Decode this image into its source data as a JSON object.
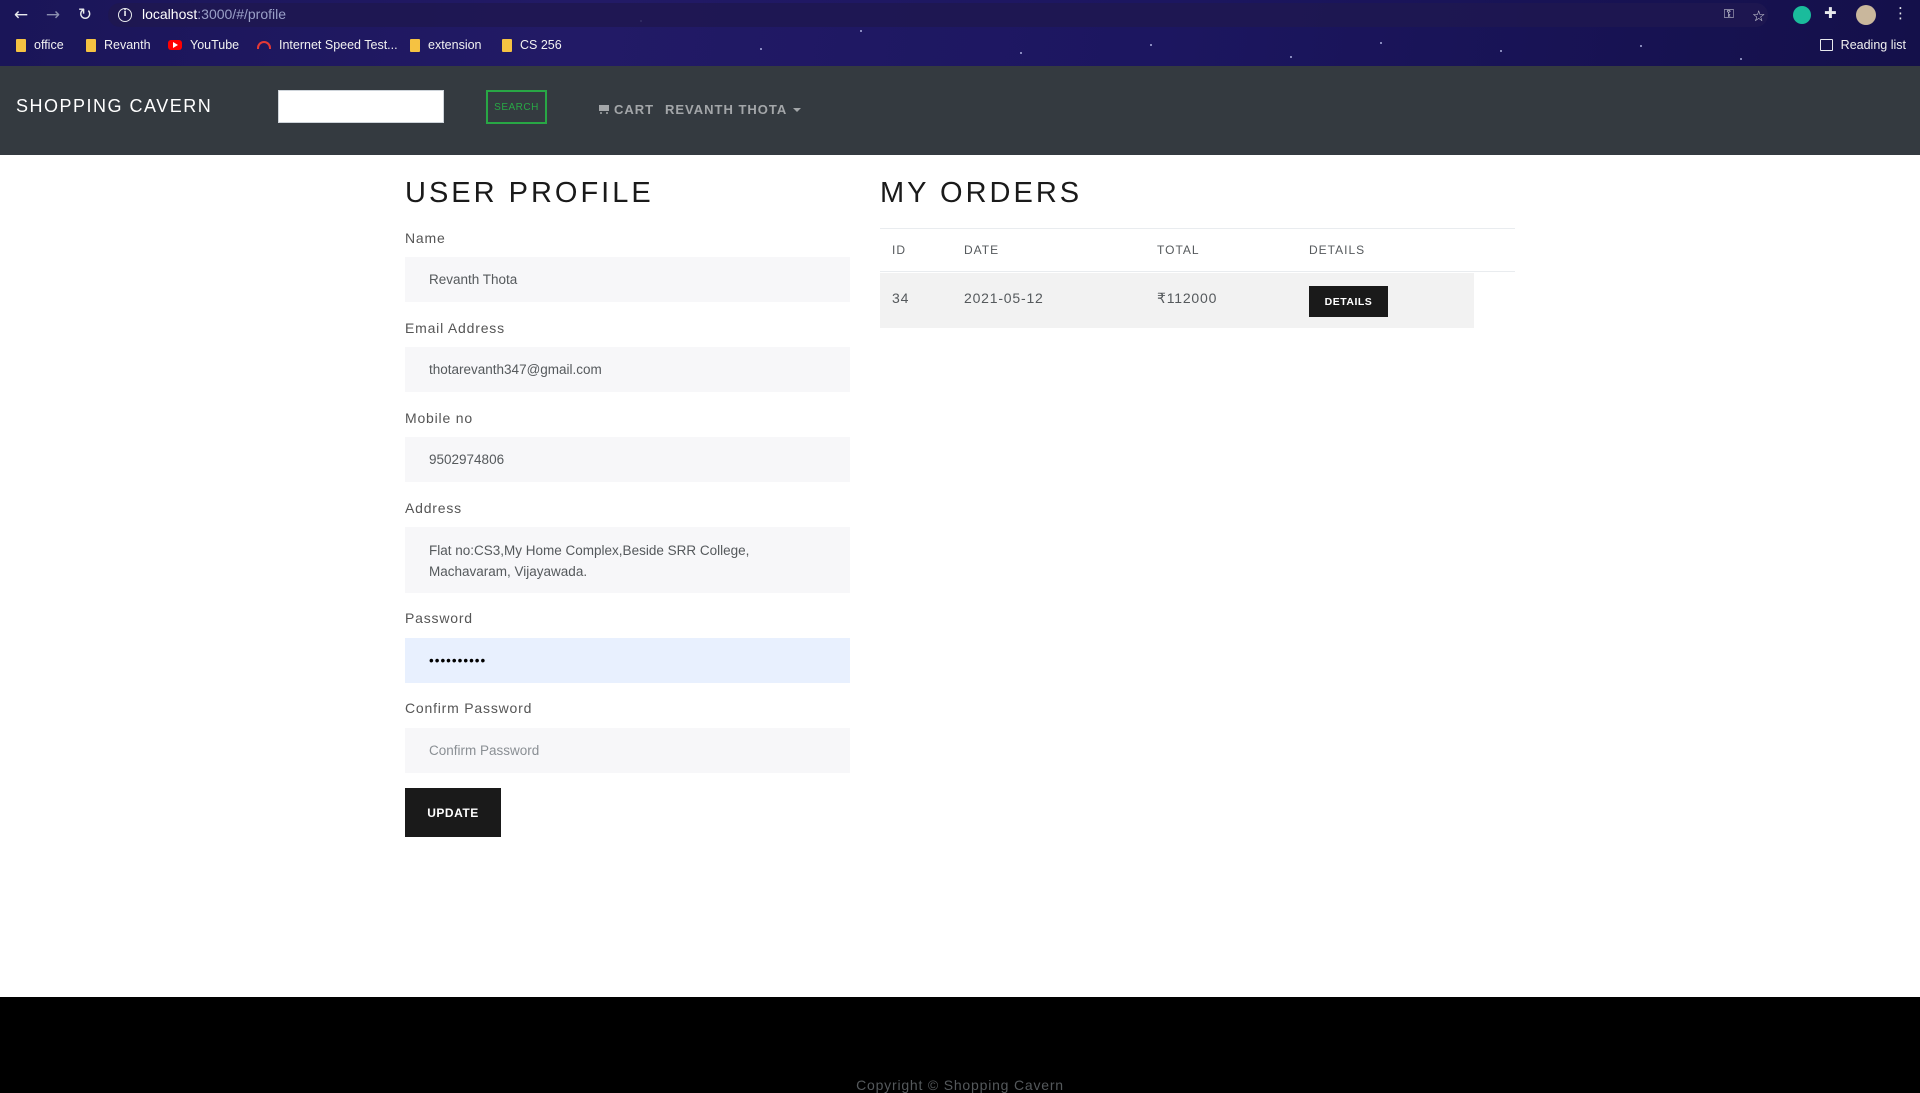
{
  "browser": {
    "url_host": "localhost",
    "url_path": ":3000/#/profile",
    "bookmarks": [
      {
        "label": "office",
        "icon": "folder-icon"
      },
      {
        "label": "Revanth",
        "icon": "folder-icon"
      },
      {
        "label": "YouTube",
        "icon": "youtube-icon"
      },
      {
        "label": "Internet Speed Test...",
        "icon": "speedometer-icon"
      },
      {
        "label": "extension",
        "icon": "folder-icon"
      },
      {
        "label": "CS 256",
        "icon": "folder-icon"
      }
    ],
    "reading_list": "Reading list"
  },
  "navbar": {
    "brand": "SHOPPING CAVERN",
    "search_value": "",
    "search_button": "SEARCH",
    "cart": "CART",
    "user_menu": "REVANTH THOTA"
  },
  "profile": {
    "title": "USER PROFILE",
    "name_label": "Name",
    "name_value": "Revanth Thota",
    "email_label": "Email Address",
    "email_value": "thotarevanth347@gmail.com",
    "mobile_label": "Mobile no",
    "mobile_value": "9502974806",
    "address_label": "Address",
    "address_value": "Flat no:CS3,My Home Complex,Beside SRR College, Machavaram, Vijayawada.",
    "password_label": "Password",
    "password_value": "••••••••••",
    "confirm_label": "Confirm Password",
    "confirm_placeholder": "Confirm Password",
    "update_button": "UPDATE"
  },
  "orders": {
    "title": "MY ORDERS",
    "headers": [
      "ID",
      "DATE",
      "TOTAL",
      "DETAILS"
    ],
    "rows": [
      {
        "id": "34",
        "date": "2021-05-12",
        "total": "₹112000",
        "details_button": "DETAILS"
      }
    ]
  },
  "footer": {
    "copyright": "Copyright © Shopping Cavern"
  },
  "colors": {
    "navbar": "#343a40",
    "search_accent": "#28a745",
    "button_dark": "#1a1a1a",
    "autofill": "#e8f0fe"
  }
}
